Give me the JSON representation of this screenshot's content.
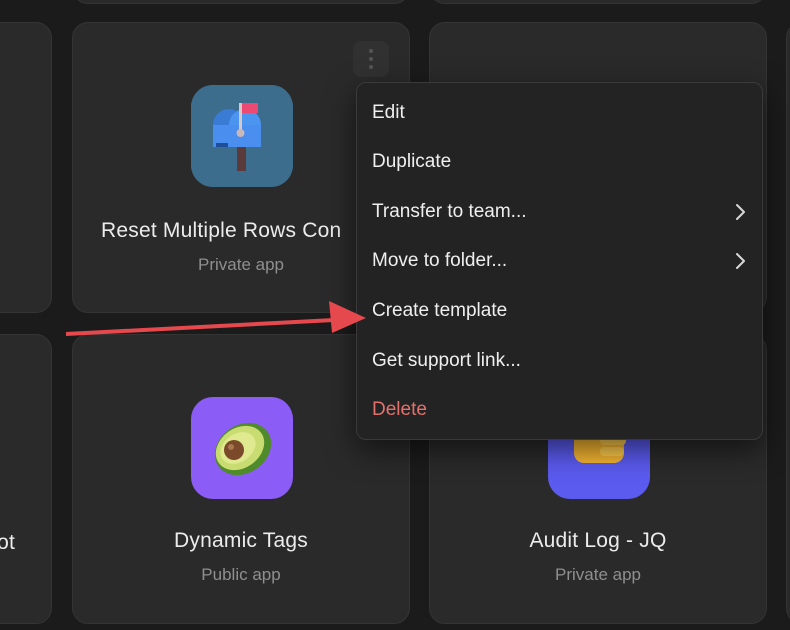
{
  "cards": [
    {
      "title": "Reset Multiple Rows Con",
      "subtitle": "Private app",
      "icon": "mailbox-icon"
    },
    {
      "title": "Dynamic Tags",
      "subtitle": "Public app",
      "icon": "avocado-icon"
    },
    {
      "title": "Audit Log - JQ",
      "subtitle": "Private app",
      "icon": "thumbs-up-icon"
    },
    {
      "title": "ot",
      "subtitle": "",
      "icon": ""
    }
  ],
  "menu": {
    "items": [
      {
        "label": "Edit",
        "submenu": false
      },
      {
        "label": "Duplicate",
        "submenu": false
      },
      {
        "label": "Transfer to team...",
        "submenu": true
      },
      {
        "label": "Move to folder...",
        "submenu": true
      },
      {
        "label": "Create template",
        "submenu": false
      },
      {
        "label": "Get support link...",
        "submenu": false
      },
      {
        "label": "Delete",
        "submenu": false
      }
    ]
  },
  "annotation": {
    "color": "#e5484d",
    "points_to": "Create template"
  },
  "colors": {
    "background": "#1b1b1b",
    "card": "#2a2a2a",
    "menu": "#232323",
    "danger": "#e4716c",
    "mailbox_tile": "#3f6f8f",
    "avocado_tile": "#8b5cf6",
    "thumbs_tile": "#5b5bf0"
  }
}
